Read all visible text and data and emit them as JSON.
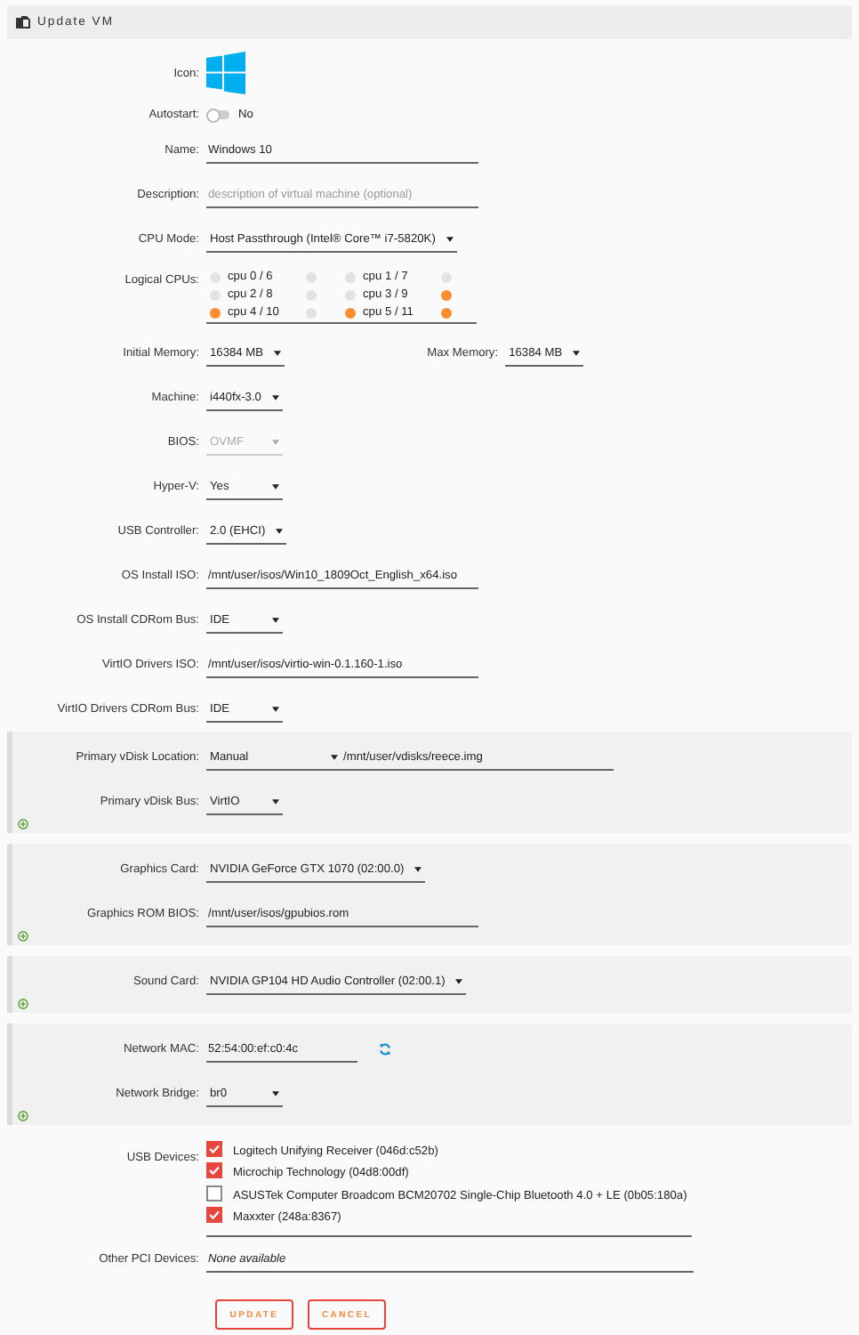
{
  "header": {
    "title": "Update VM"
  },
  "groups": [
    {
      "kind": "plain",
      "rows": [
        {
          "kind": "icon",
          "label": "Icon:"
        },
        {
          "kind": "toggle",
          "label": "Autostart:",
          "on": false,
          "value": "No"
        },
        {
          "kind": "input",
          "label": "Name:",
          "value": "Windows 10"
        },
        {
          "kind": "input",
          "label": "Description:",
          "placeholder": "description of virtual machine (optional)"
        },
        {
          "kind": "select",
          "label": "CPU Mode:",
          "value": "Host Passthrough (Intel® Core™ i7-5820K)",
          "disabled": false
        },
        {
          "kind": "cpus",
          "label": "Logical CPUs:",
          "cpus": [
            {
              "label": "cpu 0 / 6",
              "first_checked": false,
              "second_checked": false
            },
            {
              "label": "cpu 1 / 7",
              "first_checked": false,
              "second_checked": false
            },
            {
              "label": "cpu 2 / 8",
              "first_checked": false,
              "second_checked": false
            },
            {
              "label": "cpu 3 / 9",
              "first_checked": false,
              "second_checked": true
            },
            {
              "label": "cpu 4 / 10",
              "first_checked": true,
              "second_checked": false
            },
            {
              "label": "cpu 5 / 11",
              "first_checked": true,
              "second_checked": true
            }
          ]
        },
        {
          "kind": "memory",
          "label": "Initial Memory:",
          "value": "16384 MB",
          "max_label": "Max Memory:",
          "max_value": "16384 MB"
        },
        {
          "kind": "select",
          "label": "Machine:",
          "value": "i440fx-3.0",
          "disabled": false
        },
        {
          "kind": "select",
          "label": "BIOS:",
          "value": "OVMF",
          "disabled": true
        },
        {
          "kind": "select",
          "label": "Hyper-V:",
          "value": "Yes",
          "disabled": false
        },
        {
          "kind": "select",
          "label": "USB Controller:",
          "value": "2.0 (EHCI)",
          "disabled": false
        },
        {
          "kind": "input",
          "label": "OS Install ISO:",
          "value": "/mnt/user/isos/Win10_1809Oct_English_x64.iso"
        },
        {
          "kind": "select",
          "label": "OS Install CDRom Bus:",
          "value": "IDE",
          "disabled": false
        },
        {
          "kind": "input",
          "label": "VirtIO Drivers ISO:",
          "value": "/mnt/user/isos/virtio-win-0.1.160-1.iso"
        },
        {
          "kind": "select",
          "label": "VirtIO Drivers CDRom Bus:",
          "value": "IDE",
          "disabled": false
        }
      ]
    },
    {
      "kind": "panel",
      "rows": [
        {
          "kind": "location",
          "label": "Primary vDisk Location:",
          "value": "Manual",
          "path": "/mnt/user/vdisks/reece.img"
        },
        {
          "kind": "select",
          "label": "Primary vDisk Bus:",
          "value": "VirtIO",
          "disabled": false
        }
      ]
    },
    {
      "kind": "panel",
      "rows": [
        {
          "kind": "select",
          "label": "Graphics Card:",
          "value": "NVIDIA GeForce GTX 1070 (02:00.0)",
          "disabled": false
        },
        {
          "kind": "input",
          "label": "Graphics ROM BIOS:",
          "value": "/mnt/user/isos/gpubios.rom"
        }
      ]
    },
    {
      "kind": "panel",
      "rows": [
        {
          "kind": "select",
          "label": "Sound Card:",
          "value": "NVIDIA GP104 HD Audio Controller (02:00.1)",
          "disabled": false
        }
      ]
    },
    {
      "kind": "panel",
      "rows": [
        {
          "kind": "mac",
          "label": "Network MAC:",
          "value": "52:54:00:ef:c0:4c"
        },
        {
          "kind": "select",
          "label": "Network Bridge:",
          "value": "br0",
          "disabled": false
        }
      ]
    },
    {
      "kind": "plain",
      "rows": [
        {
          "kind": "usb",
          "label": "USB Devices:",
          "devices": [
            {
              "label": "Logitech Unifying Receiver (046d:c52b)",
              "checked": true
            },
            {
              "label": "Microchip Technology (04d8:00df)",
              "checked": true
            },
            {
              "label": "ASUSTek Computer Broadcom BCM20702 Single-Chip Bluetooth 4.0 + LE (0b05:180a)",
              "checked": false
            },
            {
              "label": "Maxxter (248a:8367)",
              "checked": true
            }
          ]
        },
        {
          "kind": "static",
          "label": "Other PCI Devices:",
          "value": "None available"
        }
      ]
    }
  ],
  "buttons": [
    {
      "label": "UPDATE"
    },
    {
      "label": "CANCEL"
    }
  ]
}
